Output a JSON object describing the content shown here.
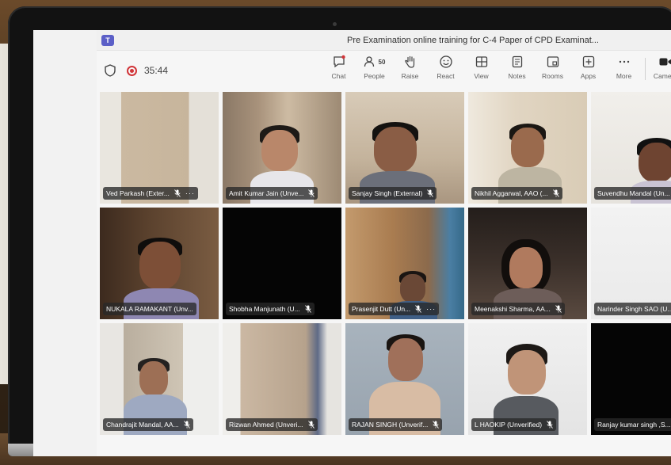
{
  "window": {
    "title": "Pre Examination online training for C-4 Paper of CPD Examinat..."
  },
  "meeting": {
    "timer": "35:44"
  },
  "toolbar": {
    "items": [
      {
        "label": "Chat",
        "icon": "chat-icon"
      },
      {
        "label": "People",
        "icon": "people-icon",
        "count": "50"
      },
      {
        "label": "Raise",
        "icon": "raise-hand-icon"
      },
      {
        "label": "React",
        "icon": "react-icon"
      },
      {
        "label": "View",
        "icon": "view-icon"
      },
      {
        "label": "Notes",
        "icon": "notes-icon"
      },
      {
        "label": "Rooms",
        "icon": "rooms-icon"
      },
      {
        "label": "Apps",
        "icon": "apps-icon"
      },
      {
        "label": "More",
        "icon": "more-icon"
      },
      {
        "label": "Camera",
        "icon": "camera-icon"
      }
    ]
  },
  "participants": [
    {
      "name": "Ved Parkash (Exter...",
      "more": "···"
    },
    {
      "name": "Amit Kumar Jain (Unve..."
    },
    {
      "name": "Sanjay Singh (External)"
    },
    {
      "name": "Nikhil Aggarwal, AAO (..."
    },
    {
      "name": "Suvendhu Mandal (Un..."
    },
    {
      "name": "NUKALA RAMAKANT (Unv..."
    },
    {
      "name": "Shobha Manjunath (U..."
    },
    {
      "name": "Prasenjit Dutt (Un...",
      "more": "···"
    },
    {
      "name": "Meenakshi Sharma, AA..."
    },
    {
      "name": "Narinder Singh SAO (U..."
    },
    {
      "name": "Chandrajit Mandal, AA..."
    },
    {
      "name": "Rizwan Ahmed (Unveri..."
    },
    {
      "name": "RAJAN SINGH (Unverif..."
    },
    {
      "name": "L HAOKIP (Unverified)"
    },
    {
      "name": "Ranjay kumar singh ,S..."
    }
  ],
  "colors": {
    "teams_purple": "#5b5fc7",
    "record_red": "#d13438",
    "nametag_bg": "#282828"
  }
}
